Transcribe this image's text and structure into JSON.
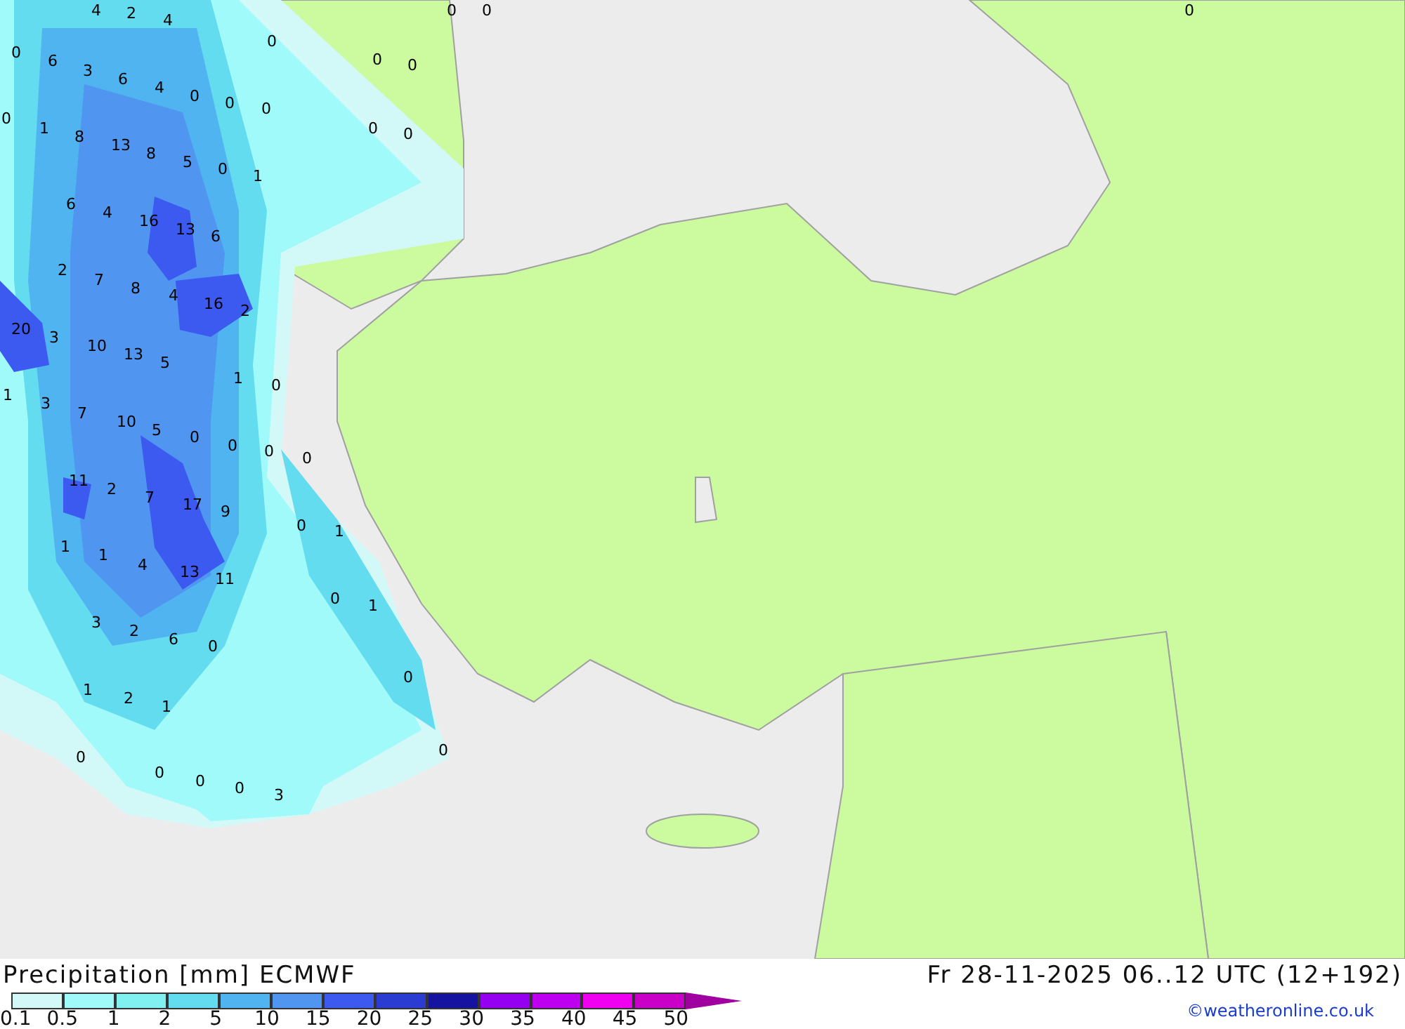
{
  "map": {
    "values": [
      "4",
      "2",
      "4",
      "0",
      "6",
      "3",
      "6",
      "4",
      "0",
      "0",
      "0",
      "0",
      "0",
      "0",
      "0",
      "0",
      "0",
      "0",
      "0",
      "0",
      "1",
      "8",
      "13",
      "8",
      "5",
      "0",
      "1",
      "6",
      "4",
      "16",
      "13",
      "6",
      "2",
      "7",
      "8",
      "4",
      "16",
      "2",
      "20",
      "3",
      "10",
      "13",
      "5",
      "1",
      "0",
      "1",
      "3",
      "7",
      "10",
      "5",
      "0",
      "0",
      "0",
      "0",
      "11",
      "2",
      "7",
      "17",
      "9",
      "0",
      "1",
      "1",
      "1",
      "4",
      "13",
      "11",
      "0",
      "1",
      "3",
      "2",
      "6",
      "0",
      "0",
      "1",
      "2",
      "1",
      "0",
      "0",
      "0",
      "0",
      "0",
      "3"
    ]
  },
  "title": "Precipitation [mm] ECMWF",
  "valid_time": "Fr 28-11-2025 06..12 UTC (12+192)",
  "legend": {
    "bins": [
      {
        "color": "#d2f8f8"
      },
      {
        "color": "#a0fafa"
      },
      {
        "color": "#80f0f0"
      },
      {
        "color": "#64dcf0"
      },
      {
        "color": "#50b4f0"
      },
      {
        "color": "#5096f0"
      },
      {
        "color": "#3c5af0"
      },
      {
        "color": "#2a3cd2"
      },
      {
        "color": "#1414a0"
      },
      {
        "color": "#9600f0"
      },
      {
        "color": "#be00f0"
      },
      {
        "color": "#f000f0"
      },
      {
        "color": "#c800c8"
      }
    ],
    "overflow": {
      "color": "#a000a0"
    },
    "ticks": [
      "0.1",
      "0.5",
      "1",
      "2",
      "5",
      "10",
      "15",
      "20",
      "25",
      "30",
      "35",
      "40",
      "45",
      "50"
    ]
  },
  "credit": "©weatheronline.co.uk"
}
